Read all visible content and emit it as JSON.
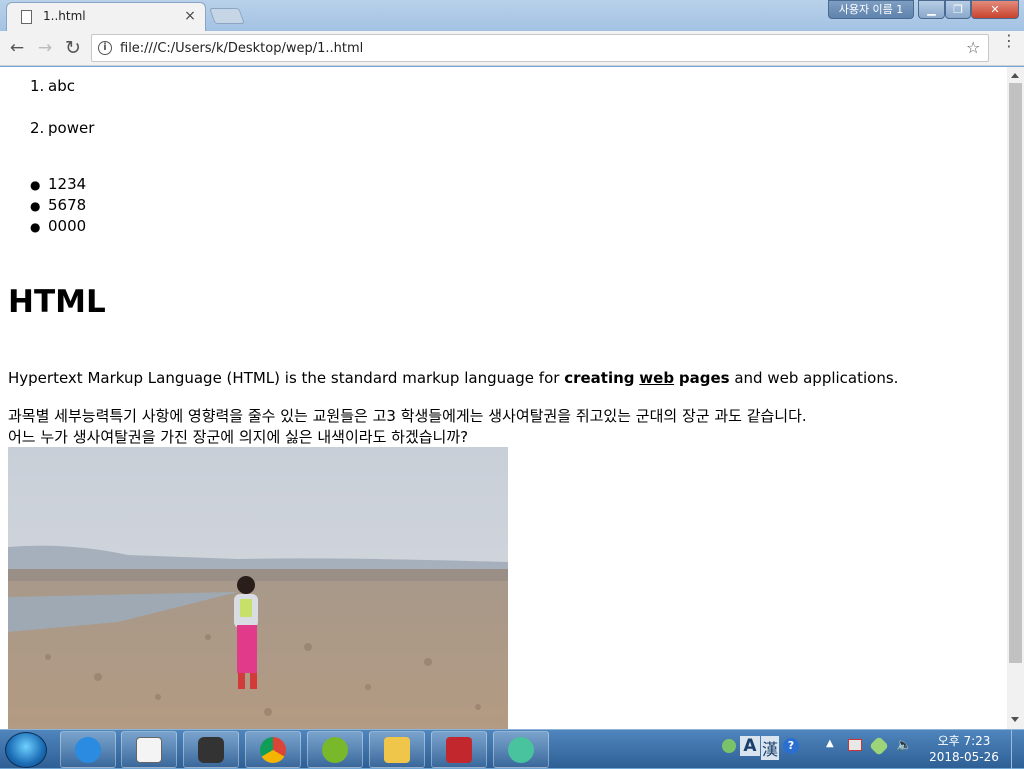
{
  "window": {
    "tab_title": "1..html",
    "tab_close": "×",
    "profile_label": "사용자 이름 1",
    "minimize": "▁",
    "maximize": "❐",
    "close": "✕"
  },
  "toolbar": {
    "back": "←",
    "forward": "→",
    "reload": "↻",
    "info": "i",
    "url": "file:///C:/Users/k/Desktop/wep/1..html",
    "star": "☆",
    "menu": "⋮"
  },
  "page": {
    "ordered_list": [
      {
        "num": "1.",
        "text": "abc"
      },
      {
        "num": "2.",
        "text": "power"
      }
    ],
    "unordered_list": [
      "1234",
      "5678",
      "0000"
    ],
    "heading": "HTML",
    "paragraph1": {
      "before": "Hypertext Markup Language (HTML) is the standard markup language for ",
      "bold1": "creating",
      "link": "web",
      "bold2": "pages",
      "after": " and web applications."
    },
    "paragraph2_line1": "과목별 세부능력특기 사항에 영향력을 줄수 있는 교원들은 고3 학생들에게는 생사여탈권을 쥐고있는 군대의 장군 과도 같습니다.",
    "paragraph2_line2": "어느 누가 생사여탈권을 가진 장군에 의지에 싫은 내색이라도 하겠습니까?"
  },
  "taskbar": {
    "clock_line1": "오후 7:23",
    "clock_line2": "2018-05-26",
    "ime_a": "A",
    "ime_han": "漢",
    "help": "?",
    "items": [
      "internet-explorer",
      "notepad",
      "nox",
      "chrome",
      "utorrent",
      "file-explorer",
      "red-app",
      "atom"
    ]
  },
  "colors": {
    "taskbar": "#2e5f95",
    "toolbar": "#f2f2f2",
    "scroll_thumb": "#c1c1c1"
  }
}
